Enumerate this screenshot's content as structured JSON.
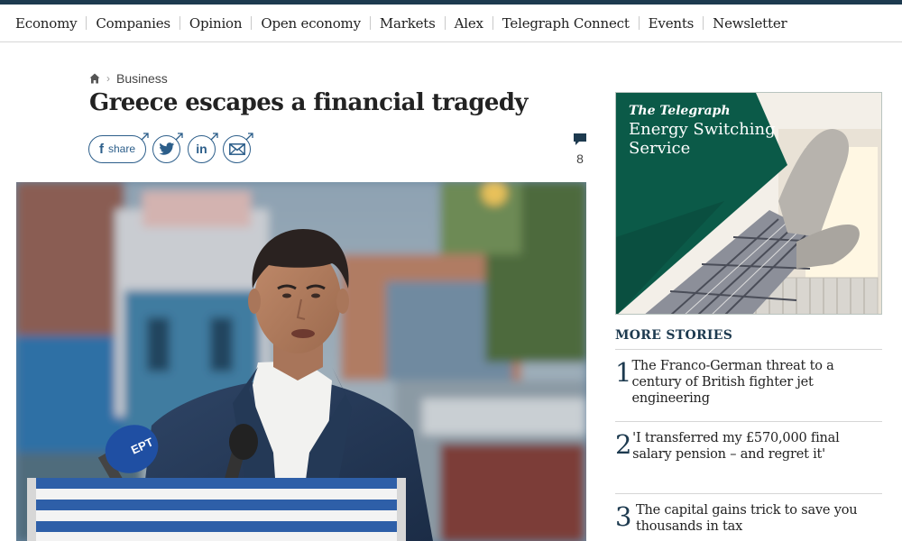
{
  "nav": {
    "items": [
      "Economy",
      "Companies",
      "Opinion",
      "Open economy",
      "Markets",
      "Alex",
      "Telegraph Connect",
      "Events",
      "Newsletter"
    ]
  },
  "breadcrumb": {
    "icon": "home-icon",
    "section": "Business"
  },
  "article": {
    "headline": "Greece escapes a financial tragedy",
    "share_label": "share",
    "comment_count": "8",
    "photo_microphone_label": "EPT"
  },
  "ad": {
    "brand": "The Telegraph",
    "title": "Energy Switching Service"
  },
  "more_stories": {
    "title": "MORE STORIES",
    "items": [
      {
        "number": "1",
        "text": "The Franco-German threat to a century of British fighter jet engineering"
      },
      {
        "number": "2",
        "text": "'I transferred my £570,000 final salary pension – and regret it'"
      },
      {
        "number": "3",
        "text": "The capital gains trick to save you thousands in tax"
      }
    ]
  },
  "colors": {
    "accent": "#1d3a4f",
    "share_blue": "#2c5e8a",
    "ad_green": "#0b5a48"
  }
}
